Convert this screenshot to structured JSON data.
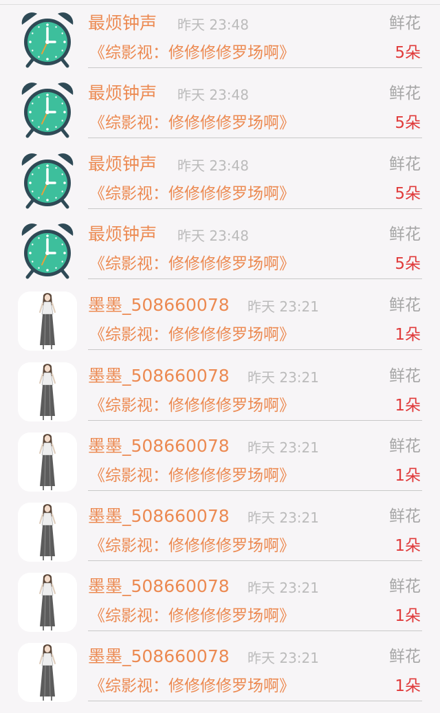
{
  "messages": [
    {
      "avatar": "alarm-clock-icon",
      "name": "最烦钟声",
      "time": "昨天 23:48",
      "gift_label": "鲜花",
      "title": "《综影视：修修修修罗场啊》",
      "count": "5朵"
    },
    {
      "avatar": "alarm-clock-icon",
      "name": "最烦钟声",
      "time": "昨天 23:48",
      "gift_label": "鲜花",
      "title": "《综影视：修修修修罗场啊》",
      "count": "5朵"
    },
    {
      "avatar": "alarm-clock-icon",
      "name": "最烦钟声",
      "time": "昨天 23:48",
      "gift_label": "鲜花",
      "title": "《综影视：修修修修罗场啊》",
      "count": "5朵"
    },
    {
      "avatar": "alarm-clock-icon",
      "name": "最烦钟声",
      "time": "昨天 23:48",
      "gift_label": "鲜花",
      "title": "《综影视：修修修修罗场啊》",
      "count": "5朵"
    },
    {
      "avatar": "girl-avatar",
      "name": "墨墨_508660078",
      "time": "昨天 23:21",
      "gift_label": "鲜花",
      "title": "《综影视：修修修修罗场啊》",
      "count": "1朵"
    },
    {
      "avatar": "girl-avatar",
      "name": "墨墨_508660078",
      "time": "昨天 23:21",
      "gift_label": "鲜花",
      "title": "《综影视：修修修修罗场啊》",
      "count": "1朵"
    },
    {
      "avatar": "girl-avatar",
      "name": "墨墨_508660078",
      "time": "昨天 23:21",
      "gift_label": "鲜花",
      "title": "《综影视：修修修修罗场啊》",
      "count": "1朵"
    },
    {
      "avatar": "girl-avatar",
      "name": "墨墨_508660078",
      "time": "昨天 23:21",
      "gift_label": "鲜花",
      "title": "《综影视：修修修修罗场啊》",
      "count": "1朵"
    },
    {
      "avatar": "girl-avatar",
      "name": "墨墨_508660078",
      "time": "昨天 23:21",
      "gift_label": "鲜花",
      "title": "《综影视：修修修修罗场啊》",
      "count": "1朵"
    },
    {
      "avatar": "girl-avatar",
      "name": "墨墨_508660078",
      "time": "昨天 23:21",
      "gift_label": "鲜花",
      "title": "《综影视：修修修修罗场啊》",
      "count": "1朵"
    }
  ],
  "colors": {
    "name": "#ec8a52",
    "count": "#e03a3a",
    "time": "#bbbbbb",
    "gift_label": "#a6a6a6",
    "clock_face": "#3dbf9c",
    "clock_frame": "#2f4a56"
  }
}
